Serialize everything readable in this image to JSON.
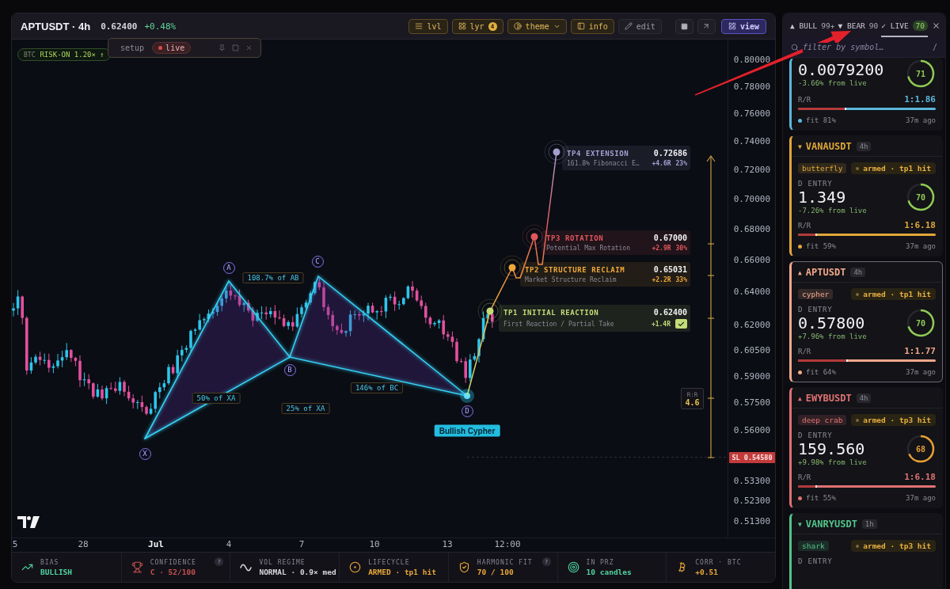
{
  "header": {
    "symbol": "APTUSDT · 4h",
    "price": "0.62400",
    "change": "+0.48%",
    "tools": [
      {
        "label": "lvl",
        "on": true,
        "dropdown": false
      },
      {
        "label": "lyr",
        "count": "4",
        "on": true,
        "dropdown": false
      },
      {
        "label": "theme",
        "on": true,
        "dropdown": true
      },
      {
        "label": "info",
        "on": true,
        "dropdown": false
      },
      {
        "label": "edit",
        "on": false,
        "dropdown": false
      }
    ],
    "view": {
      "label": "view",
      "selected": true
    }
  },
  "setup_popup": {
    "title": "setup",
    "status": "live"
  },
  "chart": {
    "market_regime": {
      "label": "BTC",
      "value": "RISK-ON 1.20× ↑"
    },
    "pattern": {
      "name": "Bullish Cypher",
      "points": [
        "X",
        "A",
        "B",
        "C",
        "D"
      ],
      "ratios": [
        "108.7% of AB",
        "50% of XA",
        "25% of XA",
        "146% of BC"
      ]
    },
    "targets": [
      {
        "title": "TP4 EXTENSION",
        "price": "0.72686",
        "note": "161.8% Fibonacci E…",
        "r_multiple": "+4.6R",
        "share": "23%",
        "hit": false,
        "color": "#a69fd0"
      },
      {
        "title": "TP3 ROTATION",
        "price": "0.67000",
        "note": "Potential Max Rotation",
        "r_multiple": "+2.9R",
        "share": "30%",
        "hit": false,
        "color": "#e2565c"
      },
      {
        "title": "TP2 STRUCTURE RECLAIM",
        "price": "0.65031",
        "note": "Market Structure Reclaim",
        "r_multiple": "+2.2R",
        "share": "33%",
        "hit": false,
        "color": "#f0a838"
      },
      {
        "title": "TP1 INITIAL REACTION",
        "price": "0.62400",
        "note": "First Reaction / Partial Take",
        "r_multiple": "+1.4R",
        "hit": true,
        "color": "#c4dc78"
      }
    ],
    "risk_reward": {
      "label": "R:R",
      "value": "4.6"
    },
    "stop_loss": "SL 0.54580",
    "price_axis": [
      "0.80000",
      "0.78000",
      "0.76000",
      "0.74000",
      "0.72000",
      "0.70000",
      "0.68000",
      "0.66000",
      "0.64000",
      "0.62000",
      "0.60500",
      "0.59000",
      "0.57500",
      "0.56000",
      "0.53300",
      "0.52300",
      "0.51300"
    ],
    "time_axis": [
      {
        "label": "5",
        "kind": "day"
      },
      {
        "label": "28",
        "kind": "day"
      },
      {
        "label": "Jul",
        "kind": "month"
      },
      {
        "label": "4",
        "kind": "day"
      },
      {
        "label": "7",
        "kind": "day"
      },
      {
        "label": "10",
        "kind": "day"
      },
      {
        "label": "13",
        "kind": "day"
      },
      {
        "label": "12:00",
        "kind": "time"
      }
    ]
  },
  "stats": [
    {
      "label": "BIAS",
      "value": "BULLISH",
      "color": "#4fd6a0"
    },
    {
      "label": "CONFIDENCE",
      "value": "C · 52/100",
      "color": "#c4524c",
      "help": "?"
    },
    {
      "label": "VOL REGIME",
      "value": "NORMAL · 0.9× med",
      "color": "#d6d6dc"
    },
    {
      "label": "LIFECYCLE",
      "value": "ARMED · tp1 hit",
      "color": "#e8a838"
    },
    {
      "label": "HARMONIC FIT",
      "value": "70 / 100",
      "color": "#e8a838",
      "help": "?"
    },
    {
      "label": "IN PRZ",
      "value": "10 candles",
      "color": "#4fd6a0"
    },
    {
      "label": "CORR · BTC",
      "value": "+0.51",
      "color": "#e8a838"
    }
  ],
  "watchlist": {
    "tabs": [
      {
        "label": "▲ BULL",
        "count": "99+",
        "selected": false
      },
      {
        "label": "▼ BEAR",
        "count": "90",
        "selected": false
      },
      {
        "label": "✓ LIVE",
        "count": "70",
        "selected": true
      }
    ],
    "search": {
      "placeholder": "filter by symbol…",
      "shortcut": "/"
    },
    "cards": [
      {
        "entry": "0.0079200",
        "change": "-3.66% from live",
        "score": "71",
        "rr_label": "R/R",
        "rr": "1:1.86",
        "risk": {
          "level": 0.35
        },
        "fit": "fit 81%",
        "age": "37m ago",
        "color": "#5cb8dc",
        "selected": false
      },
      {
        "arrow": "▼",
        "symbol": "VANAUSDT",
        "timeframe": "4h",
        "pattern": "butterfly",
        "status": "armed · tp1 hit",
        "entry_label": "D ENTRY",
        "entry": "1.349",
        "change": "-7.26% from live",
        "score": "70",
        "rr_label": "R/R",
        "rr": "1:6.18",
        "risk": {
          "level": 0.14
        },
        "fit": "fit 59%",
        "age": "37m ago",
        "color": "#e0a838",
        "selected": false
      },
      {
        "arrow": "▲",
        "symbol": "APTUSDT",
        "timeframe": "4h",
        "pattern": "cypher",
        "status": "armed · tp1 hit",
        "entry_label": "D ENTRY",
        "entry": "0.57800",
        "change": "+7.96% from live",
        "score": "70",
        "rr_label": "R/R",
        "rr": "1:1.77",
        "risk": {
          "level": 0.36
        },
        "fit": "fit 64%",
        "age": "37m ago",
        "color": "#f2a88a",
        "selected": true
      },
      {
        "arrow": "▲",
        "symbol": "EWYBUSDT",
        "timeframe": "4h",
        "pattern": "deep crab",
        "status": "armed · tp3 hit",
        "entry_label": "D ENTRY",
        "entry": "159.560",
        "change": "+9.98% from live",
        "score": "68",
        "rr_label": "R/R",
        "rr": "1:6.18",
        "risk": {
          "level": 0.14
        },
        "fit": "fit 55%",
        "age": "37m ago",
        "color": "#e07272",
        "selected": false
      },
      {
        "arrow": "▼",
        "symbol": "VANRYUSDT",
        "timeframe": "1h",
        "pattern": "shark",
        "status": "armed · tp3 hit",
        "entry_label": "D ENTRY",
        "color": "#52c48a",
        "selected": false
      }
    ]
  }
}
